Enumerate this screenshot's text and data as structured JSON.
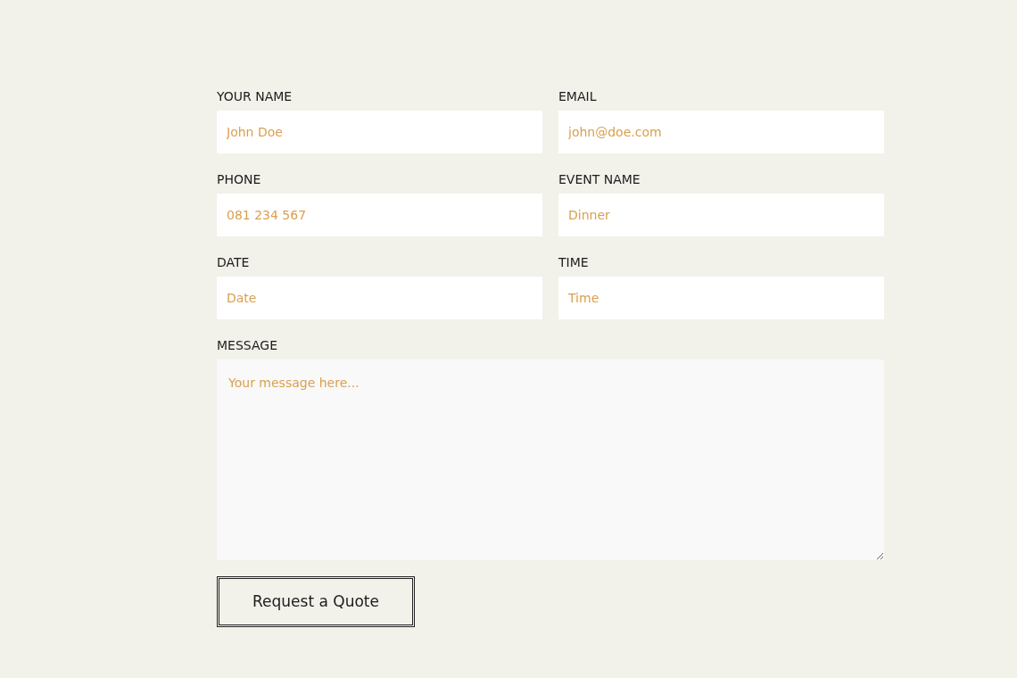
{
  "fields": [
    {
      "label": "YOUR NAME",
      "placeholder": "John Doe"
    },
    {
      "label": "EMAIL",
      "placeholder": "john@doe.com"
    },
    {
      "label": "PHONE",
      "placeholder": "081 234 567"
    },
    {
      "label": "EVENT NAME",
      "placeholder": "Dinner"
    },
    {
      "label": "DATE",
      "placeholder": "Date"
    },
    {
      "label": "TIME",
      "placeholder": "Time"
    }
  ],
  "message": {
    "label": "MESSAGE",
    "placeholder": "Your message here..."
  },
  "submit": {
    "label": "Request a Quote"
  }
}
